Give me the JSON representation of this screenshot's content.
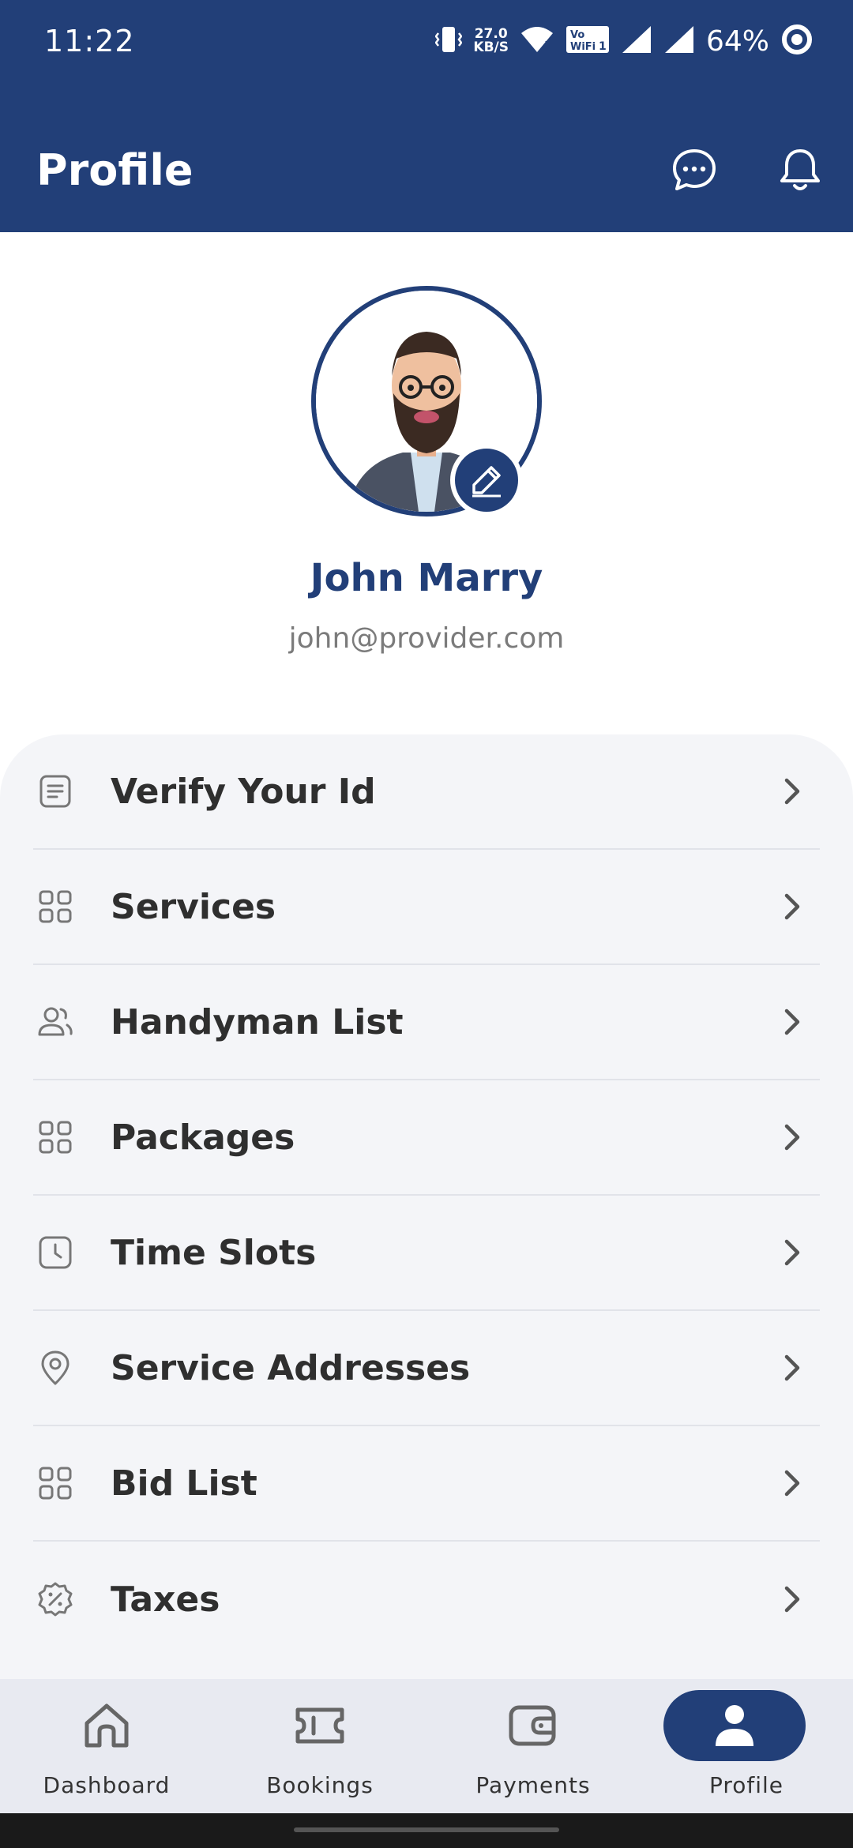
{
  "status_bar": {
    "time": "11:22",
    "network_speed_value": "27.0",
    "network_speed_unit": "KB/S",
    "volte_label": "Vo WiFi 1",
    "battery_percent": "64%"
  },
  "app_bar": {
    "title": "Profile",
    "actions": [
      "chat-icon",
      "bell-icon"
    ]
  },
  "profile": {
    "name": "John Marry",
    "email": "john@provider.com"
  },
  "menu": {
    "items": [
      {
        "label": "Verify Your Id",
        "icon": "id-document-icon"
      },
      {
        "label": "Services",
        "icon": "grid-icon"
      },
      {
        "label": "Handyman List",
        "icon": "users-icon"
      },
      {
        "label": "Packages",
        "icon": "grid-icon"
      },
      {
        "label": "Time Slots",
        "icon": "clock-icon"
      },
      {
        "label": "Service Addresses",
        "icon": "location-pin-icon"
      },
      {
        "label": "Bid List",
        "icon": "grid-icon"
      },
      {
        "label": "Taxes",
        "icon": "percent-badge-icon"
      }
    ]
  },
  "bottom_nav": {
    "items": [
      {
        "label": "Dashboard",
        "icon": "home-icon"
      },
      {
        "label": "Bookings",
        "icon": "ticket-icon"
      },
      {
        "label": "Payments",
        "icon": "wallet-icon"
      },
      {
        "label": "Profile",
        "icon": "person-icon"
      }
    ],
    "active": "Profile"
  },
  "colors": {
    "primary": "#223f78",
    "menu_background": "#f4f5f8",
    "nav_background": "#e8eaf1",
    "text_dark": "#2f2f2f",
    "text_muted": "#7b7b7b"
  }
}
